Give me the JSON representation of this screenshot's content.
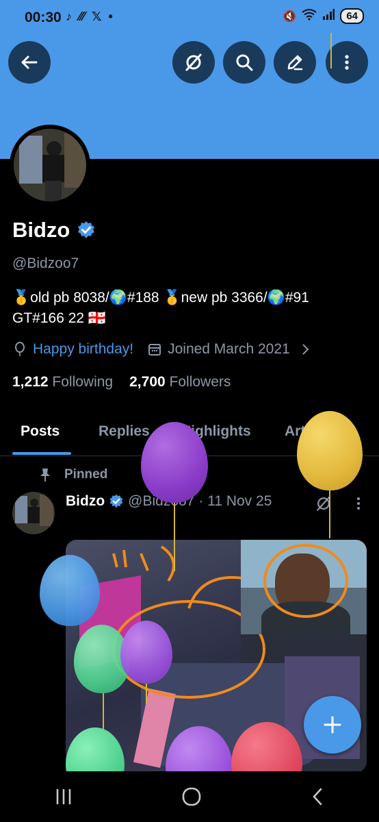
{
  "status_bar": {
    "time": "00:30",
    "left_icons": [
      "tiktok-icon",
      "signal-dots-icon",
      "x-logo-icon",
      "dot-icon"
    ],
    "battery": "64"
  },
  "profile": {
    "name": "Bidzo",
    "handle": "@Bidzoo7",
    "bio_line1": "🥇old pb 8038/🌍#188 🥇new pb 3366/🌍#91",
    "bio_line2": "GT#166 22 🇬🇪",
    "birthday": "Happy birthday!",
    "joined": "Joined March 2021",
    "following_count": "1,212",
    "following_label": "Following",
    "followers_count": "2,700",
    "followers_label": "Followers"
  },
  "tabs": [
    {
      "label": "Posts",
      "active": true
    },
    {
      "label": "Replies",
      "active": false
    },
    {
      "label": "Highlights",
      "active": false
    },
    {
      "label": "Articles",
      "active": false
    }
  ],
  "post": {
    "pinned_label": "Pinned",
    "author": "Bidzo",
    "handle": "@Bidzoo7",
    "date": "· 11 Nov 25"
  },
  "colors": {
    "accent": "#4a98e8",
    "banner": "#4a98e8",
    "background": "#000000",
    "muted": "#8b98a5"
  }
}
